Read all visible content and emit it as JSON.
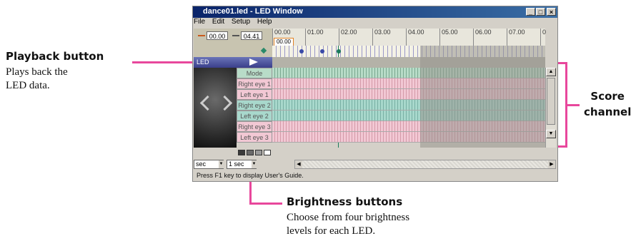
{
  "window": {
    "title": "dance01.led - LED Window",
    "buttons": {
      "minimize": "_",
      "maximize": "□",
      "close": "×"
    }
  },
  "menu": [
    "File",
    "Edit",
    "Setup",
    "Help"
  ],
  "timeline": {
    "start_time": "00.00",
    "end_time": "04.41",
    "current_time": "00.00",
    "ticks": [
      "00.00",
      "01.00",
      "02.00",
      "03.00",
      "04.00",
      "05.00",
      "06.00",
      "07.00",
      "0"
    ]
  },
  "play_row_label": "LED",
  "channels": [
    "Mode",
    "Right eye 1",
    "Left eye 1",
    "Right eye 2",
    "Left eye 2",
    "Right eye 3",
    "Left eye 3"
  ],
  "bottom": {
    "unit_select": "sec",
    "step_select": "1 sec",
    "status": "Press F1 key to display User's Guide."
  },
  "callouts": {
    "playback": {
      "title": "Playback button",
      "body": "Plays back the\nLED data."
    },
    "score": {
      "title": "Score\nchannel"
    },
    "brightness": {
      "title": "Brightness buttons",
      "body": "Choose from four brightness\nlevels for each LED."
    }
  },
  "colors": {
    "callout_line": "#e8479c",
    "title_bar": "#0a246a",
    "mode_track": "#b8dcc8",
    "red_track": "#f2c8d4",
    "green_track": "#a8d8cc"
  }
}
